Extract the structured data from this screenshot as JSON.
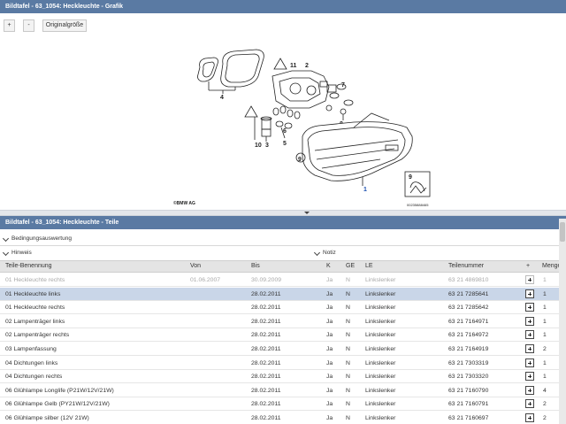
{
  "graphic_panel": {
    "title": "Bildtafel - 63_1054: Heckleuchte - Grafik",
    "zoom_in_label": "+",
    "zoom_out_label": "-",
    "original_size_label": "Originalgröße",
    "diagram": {
      "callouts": [
        "1",
        "2",
        "3",
        "4",
        "5",
        "6",
        "7",
        "8",
        "9",
        "10",
        "11"
      ],
      "copyright": "©BMW AG",
      "image_number": "00235888465"
    }
  },
  "parts_panel": {
    "title": "Bildtafel - 63_1054: Heckleuchte - Teile",
    "condition_section": "Bedingungsauswertung",
    "hint_section": "Hinweis",
    "note_section": "Notiz",
    "columns": [
      "Teile-Benennung",
      "Von",
      "Bis",
      "K",
      "GE",
      "LE",
      "Teilenummer",
      "+",
      "Menge"
    ],
    "rows": [
      {
        "name": "01 Heckleuchte rechts",
        "from": "01.06.2007",
        "to": "30.09.2009",
        "k": "Ja",
        "ge": "N",
        "le": "Linkslenker",
        "part_no": "63 21 4869810",
        "qty": "1",
        "state": "greyed"
      },
      {
        "name": "01 Heckleuchte links",
        "from": "",
        "to": "28.02.2011",
        "k": "Ja",
        "ge": "N",
        "le": "Linkslenker",
        "part_no": "63 21 7285641",
        "qty": "1",
        "state": "selected"
      },
      {
        "name": "01 Heckleuchte rechts",
        "from": "",
        "to": "28.02.2011",
        "k": "Ja",
        "ge": "N",
        "le": "Linkslenker",
        "part_no": "63 21 7285642",
        "qty": "1",
        "state": "normal"
      },
      {
        "name": "02 Lampenträger links",
        "from": "",
        "to": "28.02.2011",
        "k": "Ja",
        "ge": "N",
        "le": "Linkslenker",
        "part_no": "63 21 7164971",
        "qty": "1",
        "state": "normal"
      },
      {
        "name": "02 Lampenträger rechts",
        "from": "",
        "to": "28.02.2011",
        "k": "Ja",
        "ge": "N",
        "le": "Linkslenker",
        "part_no": "63 21 7164972",
        "qty": "1",
        "state": "normal"
      },
      {
        "name": "03 Lampenfassung",
        "from": "",
        "to": "28.02.2011",
        "k": "Ja",
        "ge": "N",
        "le": "Linkslenker",
        "part_no": "63 21 7164919",
        "qty": "2",
        "state": "normal"
      },
      {
        "name": "04 Dichtungen links",
        "from": "",
        "to": "28.02.2011",
        "k": "Ja",
        "ge": "N",
        "le": "Linkslenker",
        "part_no": "63 21 7303319",
        "qty": "1",
        "state": "normal"
      },
      {
        "name": "04 Dichtungen rechts",
        "from": "",
        "to": "28.02.2011",
        "k": "Ja",
        "ge": "N",
        "le": "Linkslenker",
        "part_no": "63 21 7303320",
        "qty": "1",
        "state": "normal"
      },
      {
        "name": "06 Glühlampe Longlife (P21W/12V/21W)",
        "from": "",
        "to": "28.02.2011",
        "k": "Ja",
        "ge": "N",
        "le": "Linkslenker",
        "part_no": "63 21 7160790",
        "qty": "4",
        "state": "normal"
      },
      {
        "name": "06 Glühlampe Gelb (PY21W/12V/21W)",
        "from": "",
        "to": "28.02.2011",
        "k": "Ja",
        "ge": "N",
        "le": "Linkslenker",
        "part_no": "63 21 7160791",
        "qty": "2",
        "state": "normal"
      },
      {
        "name": "06 Glühlampe silber (12V 21W)",
        "from": "",
        "to": "28.02.2011",
        "k": "Ja",
        "ge": "N",
        "le": "Linkslenker",
        "part_no": "63 21 7160697",
        "qty": "2",
        "state": "normal"
      }
    ]
  }
}
